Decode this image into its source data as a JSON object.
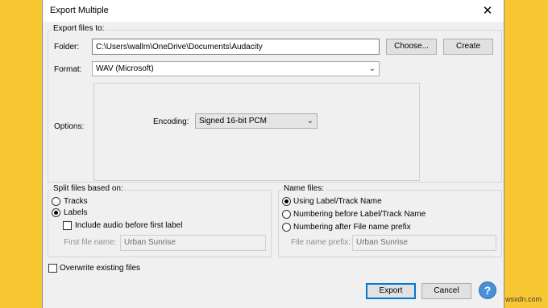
{
  "window": {
    "title": "Export Multiple",
    "close_glyph": "✕"
  },
  "export_files": {
    "group_label": "Export files to:",
    "folder_label": "Folder:",
    "folder_value": "C:\\Users\\wallm\\OneDrive\\Documents\\Audacity",
    "choose_button": "Choose...",
    "create_button": "Create",
    "format_label": "Format:",
    "format_value": "WAV (Microsoft)",
    "options_label": "Options:",
    "encoding_label": "Encoding:",
    "encoding_value": "Signed 16-bit PCM"
  },
  "split": {
    "group_label": "Split files based on:",
    "tracks_label": "Tracks",
    "labels_label": "Labels",
    "include_audio_label": "Include audio before first label",
    "first_file_name_label": "First file name:",
    "first_file_name_value": "Urban Sunrise",
    "selected": "Labels"
  },
  "name_files": {
    "group_label": "Name files:",
    "option1": "Using Label/Track Name",
    "option2": "Numbering before Label/Track Name",
    "option3": "Numbering after File name prefix",
    "prefix_label": "File name prefix:",
    "prefix_value": "Urban Sunrise",
    "selected": "Using Label/Track Name"
  },
  "overwrite_label": "Overwrite existing files",
  "buttons": {
    "export": "Export",
    "cancel": "Cancel",
    "help": "?"
  },
  "watermark": "wsxdn.com"
}
